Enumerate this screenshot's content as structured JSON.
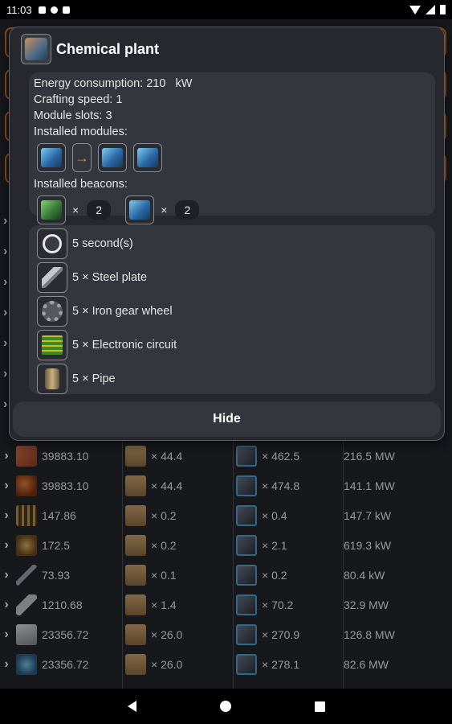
{
  "status_bar": {
    "time": "11:03"
  },
  "dialog": {
    "title": "Chemical plant",
    "icon": "chemical-plant-icon",
    "info": {
      "energy": "Energy consumption: 210   kW",
      "speed": "Crafting speed: 1",
      "slots": "Module slots: 3",
      "modules_label": "Installed modules:",
      "beacons_label": "Installed beacons:",
      "beacons": [
        {
          "icon": "beacon-icon",
          "times": "×",
          "count": "2"
        },
        {
          "icon": "beacon-module-icon",
          "times": "×",
          "count": "2"
        }
      ]
    },
    "ingredients": [
      {
        "icon": "clock-icon",
        "label": "5 second(s)"
      },
      {
        "icon": "steel-plate-icon",
        "label": "5 × Steel plate"
      },
      {
        "icon": "iron-gear-wheel-icon",
        "label": "5 × Iron gear wheel"
      },
      {
        "icon": "electronic-circuit-icon",
        "label": "5 × Electronic circuit"
      },
      {
        "icon": "pipe-icon",
        "label": "5 × Pipe"
      }
    ],
    "hide_label": "Hide"
  },
  "table": {
    "rows": [
      {
        "amount": "39883.10",
        "mult": "× 44.4",
        "machines": "× 462.5",
        "power": "216.5 MW"
      },
      {
        "amount": "39883.10",
        "mult": "× 44.4",
        "machines": "× 474.8",
        "power": "141.1 MW"
      },
      {
        "amount": "147.86",
        "mult": "× 0.2",
        "machines": "× 0.4",
        "power": "147.7 kW"
      },
      {
        "amount": "172.5",
        "mult": "× 0.2",
        "machines": "× 2.1",
        "power": "619.3 kW"
      },
      {
        "amount": "73.93",
        "mult": "× 0.1",
        "machines": "× 0.2",
        "power": "80.4 kW"
      },
      {
        "amount": "1210.68",
        "mult": "× 1.4",
        "machines": "× 70.2",
        "power": "32.9 MW"
      },
      {
        "amount": "23356.72",
        "mult": "× 26.0",
        "machines": "× 270.9",
        "power": "126.8 MW"
      },
      {
        "amount": "23356.72",
        "mult": "× 26.0",
        "machines": "× 278.1",
        "power": "82.6 MW"
      }
    ]
  }
}
